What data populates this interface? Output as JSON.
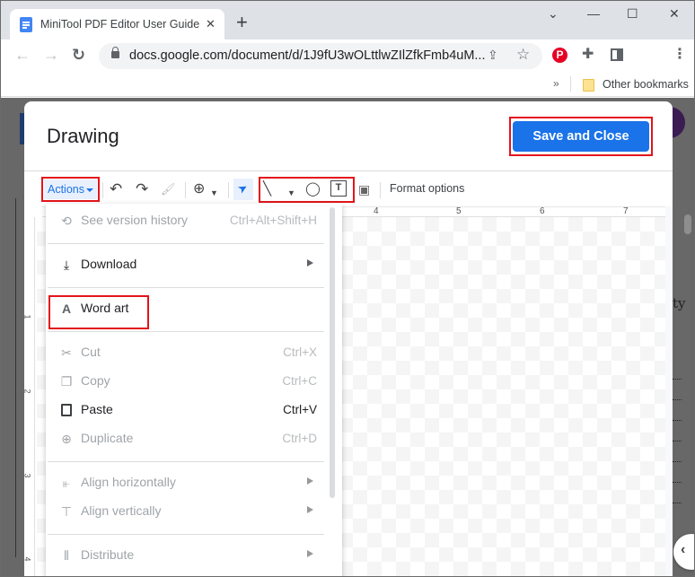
{
  "browser": {
    "tab_title": "MiniTool PDF Editor User Guide -",
    "tab_close": "✕",
    "new_tab": "+",
    "window_controls": {
      "dropdown": "⌄",
      "minimize": "—",
      "maximize": "☐",
      "close": "✕"
    },
    "nav": {
      "back": "←",
      "forward": "→",
      "reload": "↻"
    },
    "url": "docs.google.com/document/d/1J9fU3wOLttlwZIlZfkFmb4uM...",
    "share_icon": "⇪",
    "star_icon": "☆",
    "extensions": {
      "pinterest": "P",
      "puzzle": "✚",
      "menu": "⋮"
    },
    "bookmarks": {
      "overflow": "»",
      "other_bookmarks": "Other bookmarks"
    }
  },
  "dialog": {
    "title": "Drawing",
    "save_button": "Save and Close",
    "toolbar": {
      "actions": "Actions",
      "undo": "↶",
      "redo": "↷",
      "paint_format": "🖌",
      "zoom": "⊕",
      "select": "➤",
      "line": "╲",
      "shape": "◯",
      "textbox": "T",
      "image": "▣",
      "format_options": "Format options"
    },
    "ruler_h": [
      "4",
      "5",
      "6",
      "7"
    ],
    "ruler_v": [
      "1",
      "2",
      "3",
      "4"
    ]
  },
  "menu": {
    "items": [
      {
        "label": "See version history",
        "shortcut": "Ctrl+Alt+Shift+H",
        "icon": "history-icon",
        "glyph": "⟲",
        "disabled": true
      },
      {
        "label": "Download",
        "shortcut": "",
        "icon": "download-icon",
        "glyph": "⤓",
        "disabled": false,
        "submenu": true
      },
      {
        "label": "Word art",
        "shortcut": "",
        "icon": "word-art-icon",
        "glyph": "A",
        "disabled": false
      },
      {
        "label": "Cut",
        "shortcut": "Ctrl+X",
        "icon": "scissors-icon",
        "glyph": "✂",
        "disabled": true
      },
      {
        "label": "Copy",
        "shortcut": "Ctrl+C",
        "icon": "copy-icon",
        "glyph": "❐",
        "disabled": true
      },
      {
        "label": "Paste",
        "shortcut": "Ctrl+V",
        "icon": "clipboard-icon",
        "glyph": "📋",
        "disabled": false
      },
      {
        "label": "Duplicate",
        "shortcut": "Ctrl+D",
        "icon": "duplicate-icon",
        "glyph": "⊕",
        "disabled": true
      },
      {
        "label": "Align horizontally",
        "shortcut": "",
        "icon": "align-horizontal-icon",
        "glyph": "⫦",
        "disabled": true,
        "submenu": true
      },
      {
        "label": "Align vertically",
        "shortcut": "",
        "icon": "align-vertical-icon",
        "glyph": "⊤",
        "disabled": true,
        "submenu": true
      },
      {
        "label": "Distribute",
        "shortcut": "",
        "icon": "distribute-icon",
        "glyph": "⦀",
        "disabled": true,
        "submenu": true
      }
    ]
  },
  "page_behind": {
    "fragment_text": "ty",
    "collapse_icon": "‹"
  },
  "colors": {
    "accent": "#1a73e8",
    "highlight_box": "#e3141b",
    "overlay": "#686868"
  }
}
